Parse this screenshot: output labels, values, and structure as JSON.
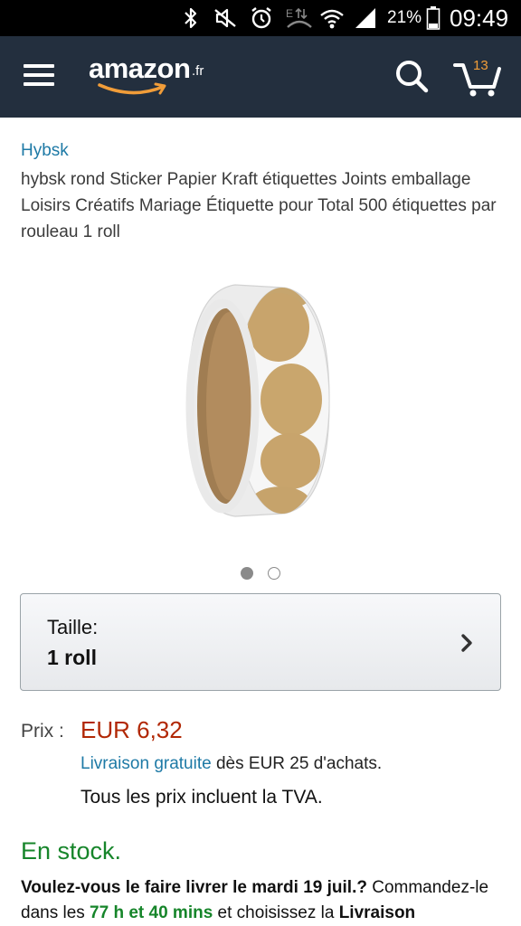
{
  "status_bar": {
    "battery": "21%",
    "time": "09:49"
  },
  "header": {
    "logo_text": "amazon",
    "logo_tld": ".fr",
    "cart_count": "13",
    "icons": [
      "menu-icon",
      "search-icon",
      "cart-icon"
    ]
  },
  "product": {
    "brand": "Hybsk",
    "title": "hybsk rond Sticker Papier Kraft étiquettes Joints emballage Loisirs Créatifs Mariage Étiquette pour Total 500 étiquettes par rouleau 1 roll",
    "image_count": 2,
    "image_active_index": 0
  },
  "size_selector": {
    "label": "Taille:",
    "value": "1 roll"
  },
  "price": {
    "label": "Prix :",
    "value": "EUR 6,32"
  },
  "delivery": {
    "free_link": "Livraison gratuite",
    "threshold_text": " dès EUR 25 d'achats.",
    "tax_note": "Tous les prix incluent la TVA."
  },
  "stock": {
    "status": "En stock."
  },
  "delivery_promo": {
    "question": "Voulez-vous le faire livrer le mardi 19 juil.?",
    "order_prefix": " Commandez-le dans les ",
    "countdown": "77 h et 40 mins",
    "order_suffix": " et choisissez la ",
    "option": "Livraison"
  },
  "colors": {
    "header_bg": "#232f3e",
    "link": "#1e7aa6",
    "price": "#b12704",
    "in_stock": "#16852a",
    "cart_count": "#f19d39"
  }
}
